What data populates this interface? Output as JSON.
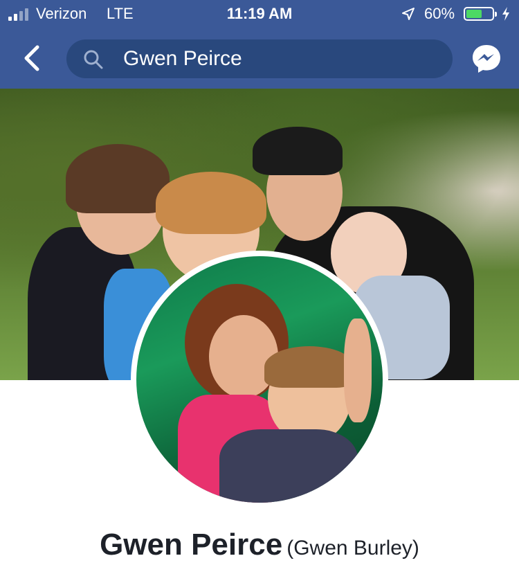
{
  "status_bar": {
    "carrier": "Verizon",
    "network": "LTE",
    "time": "11:19 AM",
    "battery_percent": "60%",
    "battery_level": 0.6,
    "signal_bars": 2
  },
  "nav": {
    "search_query": "Gwen Peirce",
    "back_icon": "chevron-left-icon",
    "search_icon": "search-icon",
    "messenger_icon": "messenger-icon"
  },
  "profile": {
    "name": "Gwen Peirce",
    "alternate_name": "(Gwen Burley)"
  },
  "colors": {
    "header_blue": "#3b5998",
    "search_field": "#29487d",
    "battery_green": "#4cd964"
  }
}
